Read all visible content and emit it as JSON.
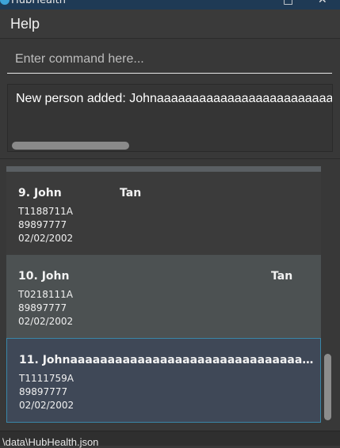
{
  "window": {
    "title": "HubHealth",
    "maximize_glyph": "□",
    "close_glyph": "✕"
  },
  "menu": {
    "help_label": "Help"
  },
  "command": {
    "placeholder": "Enter command here...",
    "value": ""
  },
  "result": {
    "text": "New person added: Johnaaaaaaaaaaaaaaaaaaaaaaaaaaaa"
  },
  "persons": [
    {
      "index": "9.",
      "first_name": "John",
      "last_name": "Tan",
      "nric": "T1188711A",
      "phone": "89897777",
      "dob": "02/02/2002"
    },
    {
      "index": "10.",
      "first_name": "John",
      "last_name": "Tan",
      "nric": "T0218111A",
      "phone": "89897777",
      "dob": "02/02/2002"
    },
    {
      "index": "11.",
      "first_name": "Johnaaaaaaaaaaaaaaaaaaaaaaaaaaaaaaaaaaaaaaaaaaaaaaaaaaaaaaaaa",
      "last_name": "",
      "nric": "T1111759A",
      "phone": "89897777",
      "dob": "02/02/2002"
    }
  ],
  "status": {
    "path": "\\data\\HubHealth.json"
  },
  "colors": {
    "background": "#383838",
    "selected_card": "#3f4857",
    "selected_border": "#3a86a8",
    "titlebar": "#1f3a55"
  }
}
